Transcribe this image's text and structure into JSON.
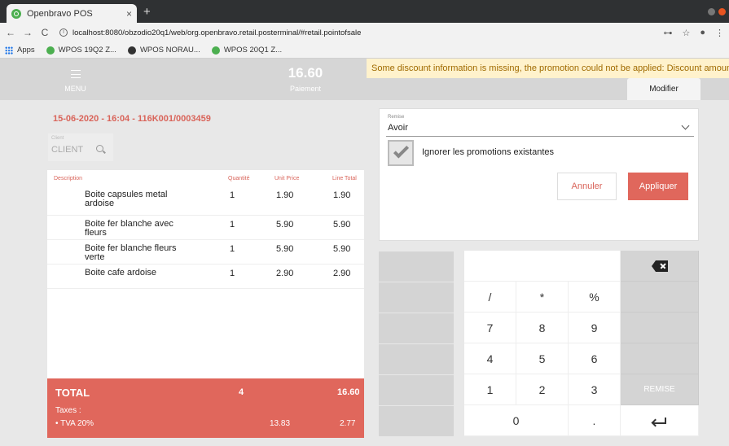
{
  "browser": {
    "tab_title": "Openbravo POS",
    "tab_close": "×",
    "new_tab": "+",
    "url": "localhost:8080/obzodio20q1/web/org.openbravo.retail.posterminal/#retail.pointofsale",
    "back": "←",
    "forward": "→",
    "reload": "C",
    "bookmarks": [
      "Apps",
      "WPOS 19Q2 Z...",
      "WPOS NORAU...",
      "WPOS 20Q1 Z..."
    ]
  },
  "topbar": {
    "menu_label": "MENU",
    "amount": "16.60",
    "pay_label": "Paiement",
    "banner": "Some discount information is missing, the promotion could not be applied: Discount amoun",
    "modifier_tab": "Modifier"
  },
  "receipt": {
    "ticket_id": "15-06-2020 - 16:04 - 116K001/0003459",
    "client_small": "Client",
    "client_label": "CLIENT",
    "headers": {
      "description": "Description",
      "qty": "Quantité",
      "unit_price": "Unit Price",
      "line_total": "Line Total"
    },
    "lines": [
      {
        "description": "Boite capsules metal ardoise",
        "qty": "1",
        "unit_price": "1.90",
        "total": "1.90"
      },
      {
        "description": "Boite fer blanche avec fleurs",
        "qty": "1",
        "unit_price": "5.90",
        "total": "5.90"
      },
      {
        "description": "Boite fer blanche fleurs verte",
        "qty": "1",
        "unit_price": "5.90",
        "total": "5.90"
      },
      {
        "description": "Boite cafe ardoise",
        "qty": "1",
        "unit_price": "2.90",
        "total": "2.90"
      }
    ],
    "total_label": "TOTAL",
    "total_qty": "4",
    "total_amount": "16.60",
    "taxes_label": "Taxes :",
    "tax_name": "• TVA 20%",
    "tax_base": "13.83",
    "tax_amount": "2.77"
  },
  "discount": {
    "remise_small": "Remise",
    "remise_value": "Avoir",
    "ignore_label": "Ignorer les promotions existantes",
    "cancel": "Annuler",
    "apply": "Appliquer"
  },
  "keypad": {
    "slash": "/",
    "star": "*",
    "percent": "%",
    "k7": "7",
    "k8": "8",
    "k9": "9",
    "k4": "4",
    "k5": "5",
    "k6": "6",
    "k1": "1",
    "k2": "2",
    "k3": "3",
    "k0": "0",
    "dot": ".",
    "remise": "REMISE"
  },
  "colors": {
    "accent": "#e0675c",
    "banner_bg": "#fff2cc"
  }
}
